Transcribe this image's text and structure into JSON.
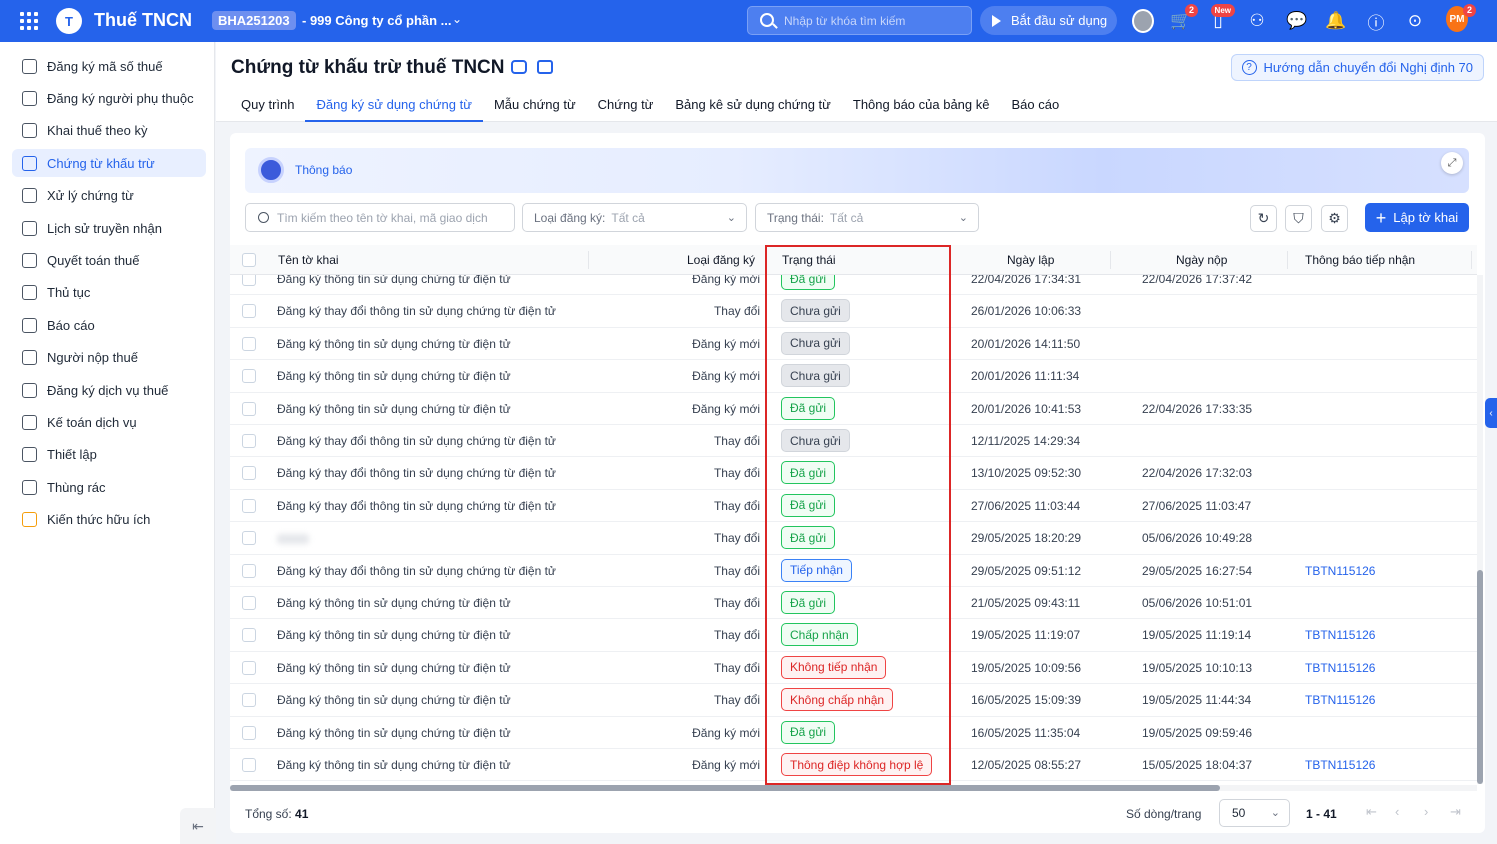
{
  "topbar": {
    "app_name": "Thuế TNCN",
    "logo_letter": "T",
    "company_code": "BHA251203",
    "company_name": "- 999 Công ty cổ phần ...",
    "search_placeholder": "Nhập từ khóa tìm kiếm",
    "start_label": "Bắt đầu sử dụng",
    "cart_badge": "2",
    "new_badge": "New",
    "user_initials": "PM",
    "user_badge": "2"
  },
  "sidebar": {
    "items": [
      {
        "label": "Đăng ký mã số thuế"
      },
      {
        "label": "Đăng ký người phụ thuộc"
      },
      {
        "label": "Khai thuế theo kỳ"
      },
      {
        "label": "Chứng từ khấu trừ"
      },
      {
        "label": "Xử lý chứng từ"
      },
      {
        "label": "Lịch sử truyền nhận"
      },
      {
        "label": "Quyết toán thuế"
      },
      {
        "label": "Thủ tục"
      },
      {
        "label": "Báo cáo"
      },
      {
        "label": "Người nộp thuế"
      },
      {
        "label": "Đăng ký dịch vụ thuế"
      },
      {
        "label": "Kế toán dịch vụ"
      },
      {
        "label": "Thiết lập"
      },
      {
        "label": "Thùng rác"
      },
      {
        "label": "Kiến thức hữu ích"
      }
    ],
    "active_index": 3
  },
  "header": {
    "title": "Chứng từ khấu trừ thuế TNCN",
    "guide_label": "Hướng dẫn chuyển đổi Nghị định 70",
    "tabs": [
      {
        "label": "Quy trình"
      },
      {
        "label": "Đăng ký sử dụng chứng từ"
      },
      {
        "label": "Mẫu chứng từ"
      },
      {
        "label": "Chứng từ"
      },
      {
        "label": "Bảng kê sử dụng chứng từ"
      },
      {
        "label": "Thông báo của bảng kê"
      },
      {
        "label": "Báo cáo"
      }
    ],
    "active_tab": 1
  },
  "banner": {
    "text": "Thông báo"
  },
  "filters": {
    "search_placeholder": "Tìm kiếm theo tên tờ khai, mã giao dịch",
    "type_label": "Loại đăng ký:",
    "type_value": "Tất cả",
    "status_label": "Trạng thái:",
    "status_value": "Tất cả",
    "create_label": "Lập tờ khai"
  },
  "table": {
    "columns": {
      "name": "Tên tờ khai",
      "type": "Loại đăng ký",
      "status": "Trạng thái",
      "created": "Ngày lập",
      "submitted": "Ngày nộp",
      "notice": "Thông báo tiếp nhận"
    },
    "rows": [
      {
        "name": "Đăng ký thông tin sử dụng chứng từ điện tử",
        "type": "Đăng ký mới",
        "status": "Đã gửi",
        "status_kind": "sent",
        "created": "22/04/2026 17:34:31",
        "submitted": "22/04/2026 17:37:42",
        "notice": ""
      },
      {
        "name": "Đăng ký thay đổi thông tin sử dụng chứng từ điện tử",
        "type": "Thay đổi",
        "status": "Chưa gửi",
        "status_kind": "draft",
        "created": "26/01/2026 10:06:33",
        "submitted": "",
        "notice": ""
      },
      {
        "name": "Đăng ký thông tin sử dụng chứng từ điện tử",
        "type": "Đăng ký mới",
        "status": "Chưa gửi",
        "status_kind": "draft",
        "created": "20/01/2026 14:11:50",
        "submitted": "",
        "notice": ""
      },
      {
        "name": "Đăng ký thông tin sử dụng chứng từ điện tử",
        "type": "Đăng ký mới",
        "status": "Chưa gửi",
        "status_kind": "draft",
        "created": "20/01/2026 11:11:34",
        "submitted": "",
        "notice": ""
      },
      {
        "name": "Đăng ký thông tin sử dụng chứng từ điện tử",
        "type": "Đăng ký mới",
        "status": "Đã gửi",
        "status_kind": "sent",
        "created": "20/01/2026 10:41:53",
        "submitted": "22/04/2026 17:33:35",
        "notice": ""
      },
      {
        "name": "Đăng ký thay đổi thông tin sử dụng chứng từ điện tử",
        "type": "Thay đổi",
        "status": "Chưa gửi",
        "status_kind": "draft",
        "created": "12/11/2025 14:29:34",
        "submitted": "",
        "notice": ""
      },
      {
        "name": "Đăng ký thay đổi thông tin sử dụng chứng từ điện tử",
        "type": "Thay đổi",
        "status": "Đã gửi",
        "status_kind": "sent",
        "created": "13/10/2025 09:52:30",
        "submitted": "22/04/2026 17:32:03",
        "notice": ""
      },
      {
        "name": "Đăng ký thay đổi thông tin sử dụng chứng từ điện tử",
        "type": "Thay đổi",
        "status": "Đã gửi",
        "status_kind": "sent",
        "created": "27/06/2025 11:03:44",
        "submitted": "27/06/2025 11:03:47",
        "notice": ""
      },
      {
        "name": "",
        "type": "Thay đổi",
        "status": "Đã gửi",
        "status_kind": "sent",
        "created": "29/05/2025 18:20:29",
        "submitted": "05/06/2026 10:49:28",
        "notice": "",
        "blurred": true
      },
      {
        "name": "Đăng ký thay đổi thông tin sử dụng chứng từ điện tử",
        "type": "Thay đổi",
        "status": "Tiếp nhận",
        "status_kind": "rec",
        "created": "29/05/2025 09:51:12",
        "submitted": "29/05/2025 16:27:54",
        "notice": "TBTN115126"
      },
      {
        "name": "Đăng ký thông tin sử dụng chứng từ điện tử",
        "type": "Thay đổi",
        "status": "Đã gửi",
        "status_kind": "sent",
        "created": "21/05/2025 09:43:11",
        "submitted": "05/06/2026 10:51:01",
        "notice": ""
      },
      {
        "name": "Đăng ký thông tin sử dụng chứng từ điện tử",
        "type": "Thay đổi",
        "status": "Chấp nhận",
        "status_kind": "acc",
        "created": "19/05/2025 11:19:07",
        "submitted": "19/05/2025 11:19:14",
        "notice": "TBTN115126"
      },
      {
        "name": "Đăng ký thông tin sử dụng chứng từ điện tử",
        "type": "Thay đổi",
        "status": "Không tiếp nhận",
        "status_kind": "rej",
        "created": "19/05/2025 10:09:56",
        "submitted": "19/05/2025 10:10:13",
        "notice": "TBTN115126"
      },
      {
        "name": "Đăng ký thông tin sử dụng chứng từ điện tử",
        "type": "Thay đổi",
        "status": "Không chấp nhận",
        "status_kind": "rej",
        "created": "16/05/2025 15:09:39",
        "submitted": "19/05/2025 11:44:34",
        "notice": "TBTN115126"
      },
      {
        "name": "Đăng ký thông tin sử dụng chứng từ điện tử",
        "type": "Đăng ký mới",
        "status": "Đã gửi",
        "status_kind": "sent",
        "created": "16/05/2025 11:35:04",
        "submitted": "19/05/2025 09:59:46",
        "notice": ""
      },
      {
        "name": "Đăng ký thông tin sử dụng chứng từ điện tử",
        "type": "Đăng ký mới",
        "status": "Thông điệp không hợp lệ",
        "status_kind": "rej",
        "created": "12/05/2025 08:55:27",
        "submitted": "15/05/2025 18:04:37",
        "notice": "TBTN115126"
      }
    ]
  },
  "footer": {
    "total_label": "Tổng số:",
    "total_value": "41",
    "per_page_label": "Số dòng/trang",
    "per_page_value": "50",
    "range": "1 - 41"
  }
}
